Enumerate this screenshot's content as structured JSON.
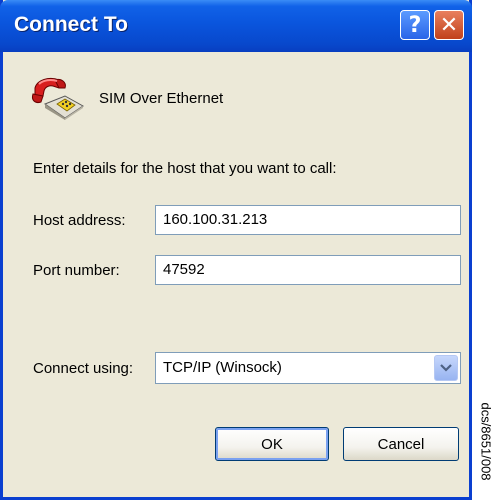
{
  "window": {
    "title": "Connect To"
  },
  "titlebar": {
    "help_glyph": "?",
    "close_glyph": "✕"
  },
  "connection": {
    "name": "SIM Over Ethernet",
    "icon": "phone-icon"
  },
  "prompt": "Enter details for the host that you want to call:",
  "host": {
    "label": "Host address:",
    "value": "160.100.31.213"
  },
  "port": {
    "label": "Port number:",
    "value": "47592"
  },
  "connect": {
    "label": "Connect using:",
    "selected": "TCP/IP (Winsock)"
  },
  "buttons": {
    "ok": "OK",
    "cancel": "Cancel"
  },
  "side_code": "dcs/8651/008",
  "colors": {
    "title_bar": "#0a55dd",
    "dialog_bg": "#ece9d8",
    "close": "#c1411b",
    "field_border": "#7f9db9"
  }
}
